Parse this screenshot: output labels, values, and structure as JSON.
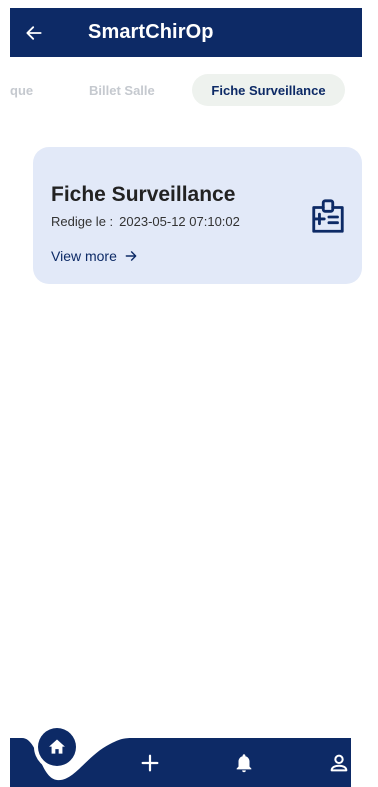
{
  "app": {
    "title": "SmartChirOp"
  },
  "tabs": [
    {
      "label": "que",
      "selected": false
    },
    {
      "label": "Billet Salle",
      "selected": false
    },
    {
      "label": "Fiche Surveillance",
      "selected": true
    }
  ],
  "card": {
    "title": "Fiche Surveillance",
    "date_label": "Redige le :",
    "date_value": "2023-05-12 07:10:02",
    "view_more": "View more",
    "icon": "medical-badge-icon"
  },
  "bottom_nav": {
    "items": [
      {
        "icon": "home-icon",
        "active": true
      },
      {
        "icon": "plus-icon",
        "active": false
      },
      {
        "icon": "bell-icon",
        "active": false
      },
      {
        "icon": "user-icon",
        "active": false
      }
    ]
  },
  "colors": {
    "primary": "#0d2a66",
    "card_bg": "#e2e9f8",
    "tab_selected_bg": "#eef2ee",
    "tab_inactive": "#c5c9cf"
  }
}
